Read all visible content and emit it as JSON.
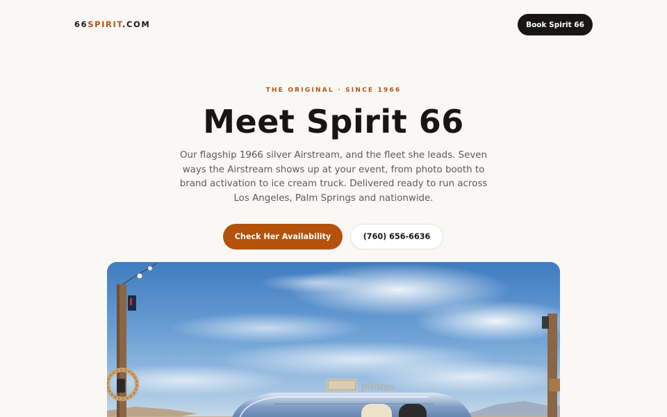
{
  "nav": {
    "logo_prefix": "66",
    "logo_accent": "SPIRIT",
    "logo_suffix": ".COM",
    "cta_label": "Book Spirit 66"
  },
  "hero": {
    "eyebrow": "THE ORIGINAL · SINCE 1966",
    "title": "Meet Spirit 66",
    "lede": "Our flagship 1966 silver Airstream, and the fleet she leads. Seven ways the Airstream shows up at your event, from photo booth to brand activation to ice cream truck. Delivered ready to run across Los Angeles, Palm Springs and nationwide.",
    "primary_button": "Check Her Availability",
    "secondary_button": "(760) 656-6636"
  },
  "image": {
    "sign_text": "photos"
  },
  "colors": {
    "accent": "#b5520f",
    "dark": "#181614",
    "background": "#faf8f5"
  }
}
